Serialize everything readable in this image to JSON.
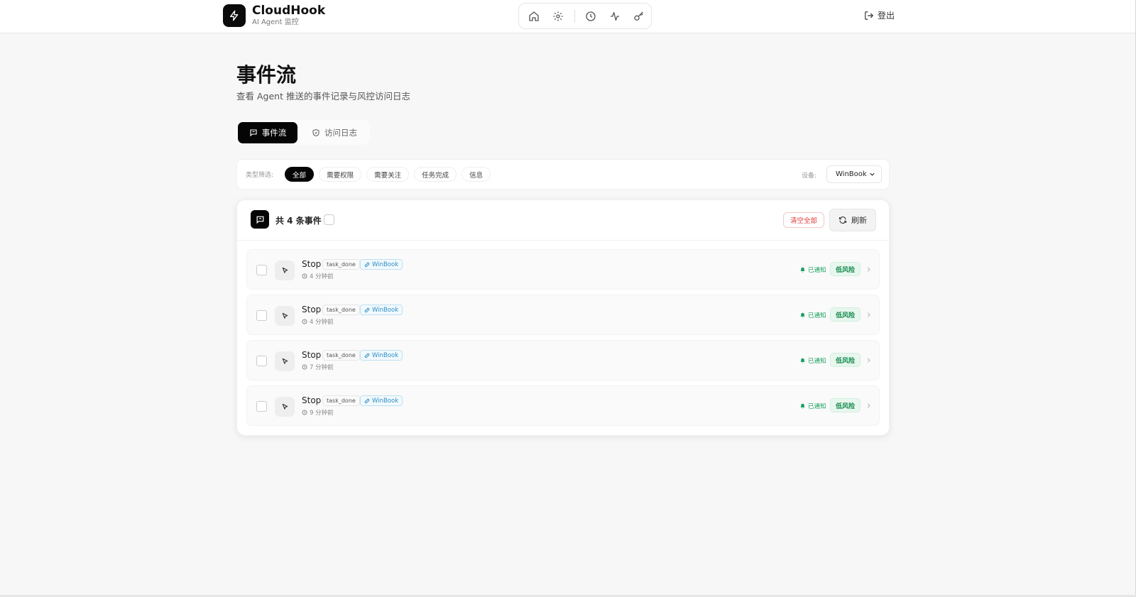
{
  "header": {
    "brand_name": "CloudHook",
    "brand_sub": "AI Agent 监控",
    "logout_label": "登出",
    "nav_icons": [
      "home-icon",
      "gear-icon",
      "clock-icon",
      "activity-icon",
      "key-icon"
    ]
  },
  "page": {
    "title": "事件流",
    "subtitle": "查看 Agent 推送的事件记录与风控访问日志"
  },
  "tabs": [
    {
      "label": "事件流",
      "icon": "message-icon",
      "active": true
    },
    {
      "label": "访问日志",
      "icon": "shield-icon",
      "active": false
    }
  ],
  "filter": {
    "type_label": "类型筛选:",
    "chips": [
      "全部",
      "需要权限",
      "需要关注",
      "任务完成",
      "信息"
    ],
    "active_chip": "全部",
    "device_label": "设备:",
    "device_value": "WinBook"
  },
  "events": {
    "count_label": "共 4 条事件",
    "clear_label": "清空全部",
    "refresh_label": "刷新",
    "items": [
      {
        "name": "Stop",
        "type": "task_done",
        "device": "WinBook",
        "time": "4 分钟前",
        "notified": "已通知",
        "risk": "低风险"
      },
      {
        "name": "Stop",
        "type": "task_done",
        "device": "WinBook",
        "time": "4 分钟前",
        "notified": "已通知",
        "risk": "低风险"
      },
      {
        "name": "Stop",
        "type": "task_done",
        "device": "WinBook",
        "time": "7 分钟前",
        "notified": "已通知",
        "risk": "低风险"
      },
      {
        "name": "Stop",
        "type": "task_done",
        "device": "WinBook",
        "time": "9 分钟前",
        "notified": "已通知",
        "risk": "低风险"
      }
    ]
  },
  "colors": {
    "accent": "#050505",
    "danger": "#e03b3b",
    "success": "#17a05d",
    "device": "#2b8fc4"
  }
}
